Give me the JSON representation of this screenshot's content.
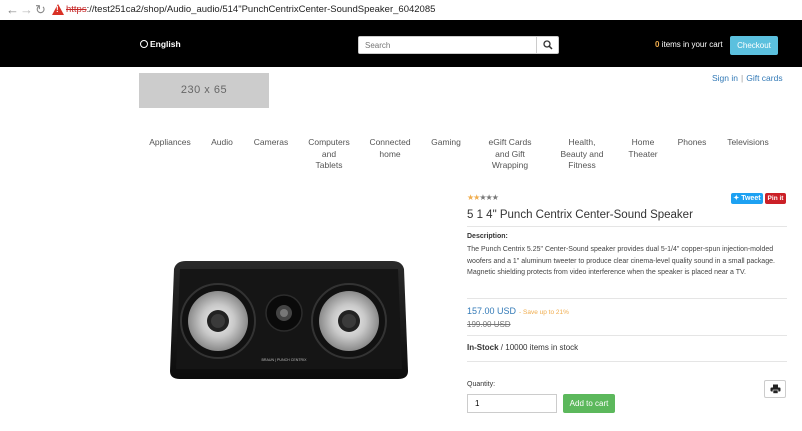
{
  "browser": {
    "url_scheme": "https",
    "url_rest": "://test251ca2/shop/Audio_audio/514\"PunchCentrixCenter-SoundSpeaker_6042085"
  },
  "header": {
    "language": "English",
    "search_placeholder": "Search",
    "cart_count": "0",
    "cart_label": "items in your cart",
    "checkout_label": "Checkout",
    "logo_text": "230 x 65",
    "signin_label": "Sign in",
    "giftcards_label": "Gift cards"
  },
  "categories": [
    {
      "line1": "Appliances",
      "line2": "",
      "line3": ""
    },
    {
      "line1": "Audio",
      "line2": "",
      "line3": ""
    },
    {
      "line1": "Cameras",
      "line2": "",
      "line3": ""
    },
    {
      "line1": "Computers",
      "line2": "and",
      "line3": "Tablets"
    },
    {
      "line1": "Connected",
      "line2": "home",
      "line3": ""
    },
    {
      "line1": "Gaming",
      "line2": "",
      "line3": ""
    },
    {
      "line1": "eGift Cards",
      "line2": "and Gift",
      "line3": "Wrapping"
    },
    {
      "line1": "Health,",
      "line2": "Beauty and",
      "line3": "Fitness"
    },
    {
      "line1": "Home",
      "line2": "Theater",
      "line3": ""
    },
    {
      "line1": "Phones",
      "line2": "",
      "line3": ""
    },
    {
      "line1": "Televisions",
      "line2": "",
      "line3": ""
    }
  ],
  "product": {
    "rating": 2,
    "rating_max": 5,
    "tweet_label": "Tweet",
    "pin_label": "Pin it",
    "title": "5 1 4\" Punch Centrix Center-Sound Speaker",
    "description_heading": "Description:",
    "description": "The Punch Centrix 5.25\" Center-Sound speaker provides dual 5-1/4\" copper-spun injection-molded woofers and a 1\" aluminum tweeter to produce clear cinema-level quality sound in a small package. Magnetic shielding protects from video interference when the speaker is placed near a TV.",
    "price": "157.00 USD",
    "savings": "- Save up to 21%",
    "old_price": "199.00 USD",
    "stock_status": "In-Stock",
    "stock_detail": "/ 10000 items in stock",
    "quantity_label": "Quantity:",
    "quantity_value": "1",
    "add_to_cart_label": "Add to cart",
    "speaker_brand": "BRAUN | PUNCH CENTRIX"
  }
}
